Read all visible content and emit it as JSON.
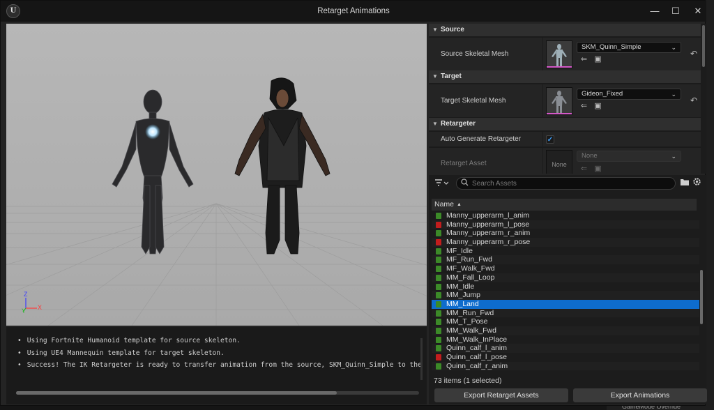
{
  "window": {
    "title": "Retarget Animations",
    "logo_text": "U",
    "minimize_glyph": "—",
    "maximize_glyph": "☐",
    "close_glyph": "✕"
  },
  "background_app": {
    "bottom_text": "GameMode Override"
  },
  "viewport": {
    "background_color": "#b5b5b5",
    "axis_labels": {
      "z": "Z",
      "y": "Y",
      "x": "X"
    }
  },
  "log": {
    "lines": [
      "Using Fortnite Humanoid template for source skeleton.",
      "Using UE4 Mannequin template for target skeleton.",
      "Success! The IK Retargeter is ready to transfer animation from the source, SKM_Quinn_Simple to the target, Gideon_Fixed."
    ]
  },
  "details": {
    "source": {
      "header": "Source",
      "label": "Source Skeletal Mesh",
      "value": "SKM_Quinn_Simple"
    },
    "target": {
      "header": "Target",
      "label": "Target Skeletal Mesh",
      "value": "Gideon_Fixed"
    },
    "retargeter": {
      "header": "Retargeter",
      "auto_label": "Auto Generate Retargeter",
      "auto_checked": true,
      "asset_label": "Retarget Asset",
      "asset_thumb_text": "None",
      "asset_value": "None"
    },
    "icons": {
      "use": "⇐",
      "browse": "▣",
      "reset": "↶",
      "check": "✓",
      "chevron": "⌄",
      "triangle": "▼"
    }
  },
  "browser": {
    "search_placeholder": "Search Assets",
    "column_name": "Name",
    "sort_glyph": "▲",
    "rows": [
      {
        "label": "Manny_upperarm_l_anim",
        "kind": "anim",
        "selected": false
      },
      {
        "label": "Manny_upperarm_l_pose",
        "kind": "pose",
        "selected": false
      },
      {
        "label": "Manny_upperarm_r_anim",
        "kind": "anim",
        "selected": false
      },
      {
        "label": "Manny_upperarm_r_pose",
        "kind": "pose",
        "selected": false
      },
      {
        "label": "MF_Idle",
        "kind": "anim",
        "selected": false
      },
      {
        "label": "MF_Run_Fwd",
        "kind": "anim",
        "selected": false
      },
      {
        "label": "MF_Walk_Fwd",
        "kind": "anim",
        "selected": false
      },
      {
        "label": "MM_Fall_Loop",
        "kind": "anim",
        "selected": false
      },
      {
        "label": "MM_Idle",
        "kind": "anim",
        "selected": false
      },
      {
        "label": "MM_Jump",
        "kind": "anim",
        "selected": false
      },
      {
        "label": "MM_Land",
        "kind": "anim",
        "selected": true
      },
      {
        "label": "MM_Run_Fwd",
        "kind": "anim",
        "selected": false
      },
      {
        "label": "MM_T_Pose",
        "kind": "anim",
        "selected": false
      },
      {
        "label": "MM_Walk_Fwd",
        "kind": "anim",
        "selected": false
      },
      {
        "label": "MM_Walk_InPlace",
        "kind": "anim",
        "selected": false
      },
      {
        "label": "Quinn_calf_l_anim",
        "kind": "anim",
        "selected": false
      },
      {
        "label": "Quinn_calf_l_pose",
        "kind": "pose",
        "selected": false
      },
      {
        "label": "Quinn_calf_r_anim",
        "kind": "anim",
        "selected": false
      }
    ],
    "count_text": "73 items (1 selected)",
    "export_assets_label": "Export Retarget Assets",
    "export_anims_label": "Export Animations"
  }
}
